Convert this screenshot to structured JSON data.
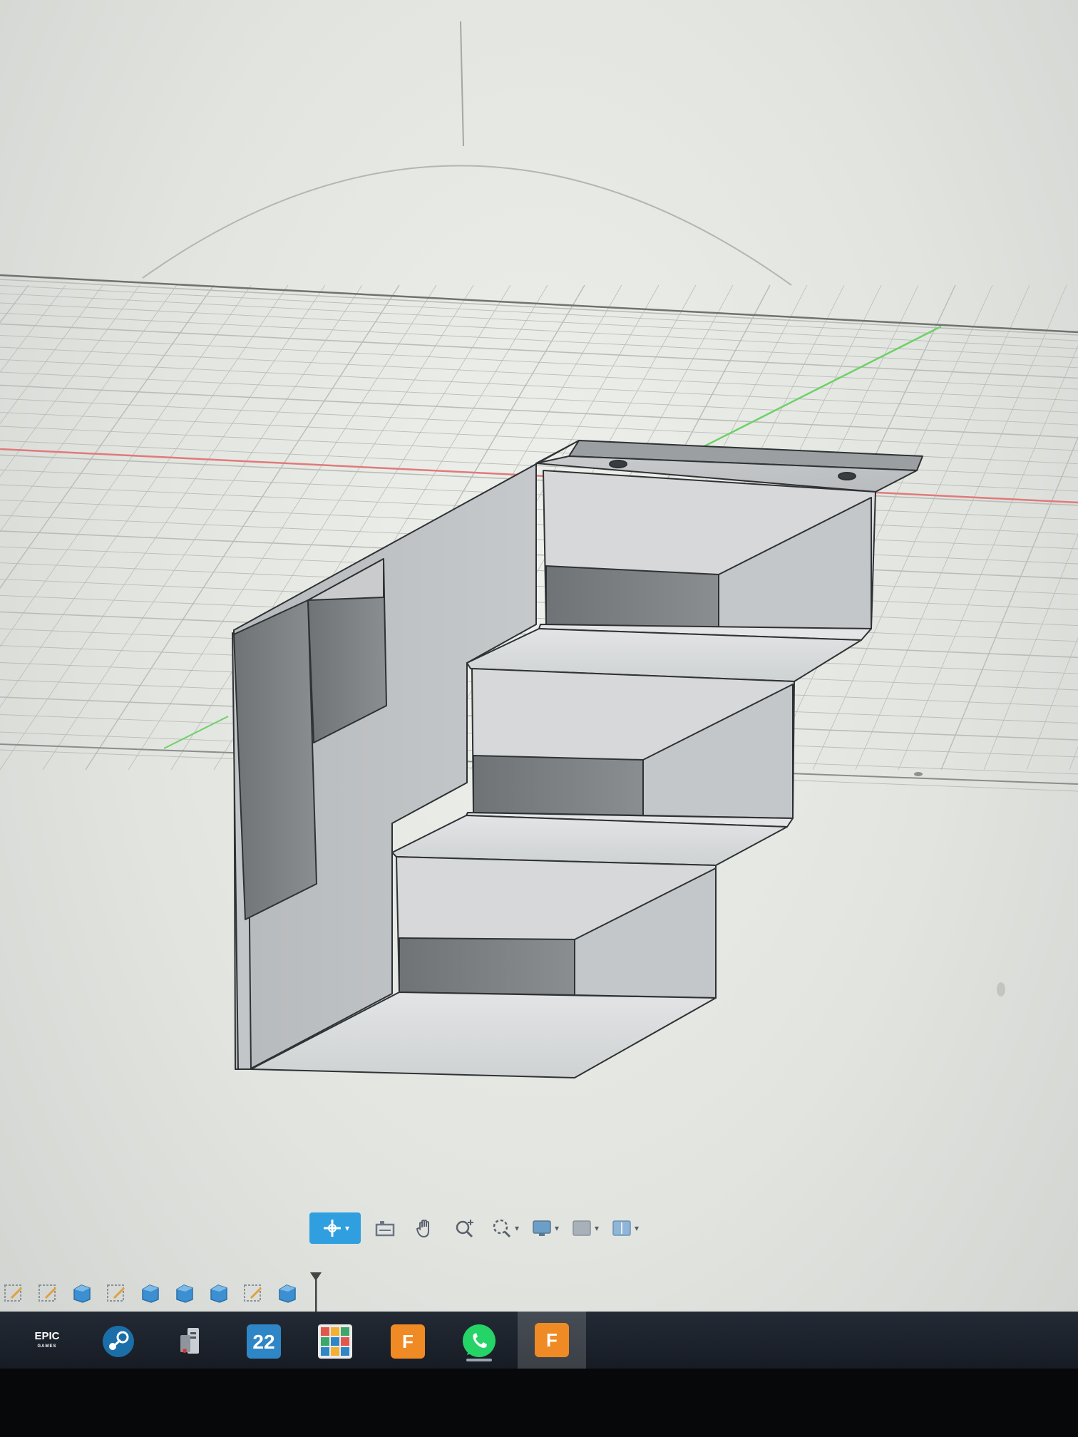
{
  "viewport": {
    "background": "#e6e8e4",
    "grid_color": "#b9bcb8",
    "x_axis_color": "#e07a7a",
    "z_axis_color": "#6fd06a",
    "model_color": "#a9acae"
  },
  "nav_toolbar": {
    "items": [
      {
        "icon": "orbit-icon",
        "active": true
      },
      {
        "icon": "look-at-icon"
      },
      {
        "icon": "pan-hand-icon"
      },
      {
        "icon": "zoom-icon"
      },
      {
        "icon": "fit-icon",
        "dropdown": true
      },
      {
        "icon": "display-settings-icon",
        "dropdown": true
      },
      {
        "icon": "grid-settings-icon",
        "dropdown": true
      },
      {
        "icon": "viewports-icon",
        "dropdown": true
      }
    ]
  },
  "timeline": {
    "items": [
      "sketch",
      "sketch",
      "extrude",
      "sketch",
      "extrude",
      "extrude",
      "extrude",
      "sketch",
      "extrude"
    ]
  },
  "taskbar": {
    "apps": [
      {
        "name": "Epic Games",
        "label_line1": "EPIC",
        "label_line2": "GAMES"
      },
      {
        "name": "Steam"
      },
      {
        "name": "PC Manager"
      },
      {
        "name": "App 22",
        "label": "22"
      },
      {
        "name": "Calendar App"
      },
      {
        "name": "Fusion 360",
        "label": "F"
      },
      {
        "name": "WhatsApp"
      },
      {
        "name": "Fusion 360",
        "label": "F",
        "active": true
      }
    ]
  }
}
